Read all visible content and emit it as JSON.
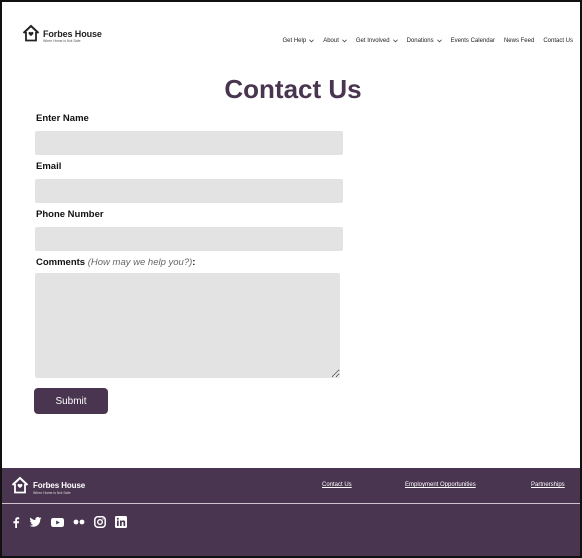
{
  "brand": {
    "name": "Forbes House",
    "tagline": "When Home is Not Safe"
  },
  "nav": [
    {
      "label": "Get Help",
      "dropdown": true
    },
    {
      "label": "About",
      "dropdown": true
    },
    {
      "label": "Get Involved",
      "dropdown": true
    },
    {
      "label": "Donations",
      "dropdown": true
    },
    {
      "label": "Events Calendar",
      "dropdown": false
    },
    {
      "label": "News Feed",
      "dropdown": false
    },
    {
      "label": "Contact Us",
      "dropdown": false
    }
  ],
  "page": {
    "title": "Contact Us"
  },
  "form": {
    "name_label": "Enter Name",
    "email_label": "Email",
    "phone_label": "Phone Number",
    "comments_label": "Comments",
    "comments_hint": "(How may we help you?)",
    "comments_suffix": ":",
    "submit_label": "Submit"
  },
  "footer": {
    "links": [
      "Contact Us",
      "Employment Opportunities",
      "Partnerships"
    ],
    "social": [
      "facebook-icon",
      "twitter-icon",
      "youtube-icon",
      "flickr-icon",
      "instagram-icon",
      "linkedin-icon"
    ]
  },
  "colors": {
    "brand": "#4a3550",
    "field": "#e3e3e3"
  }
}
